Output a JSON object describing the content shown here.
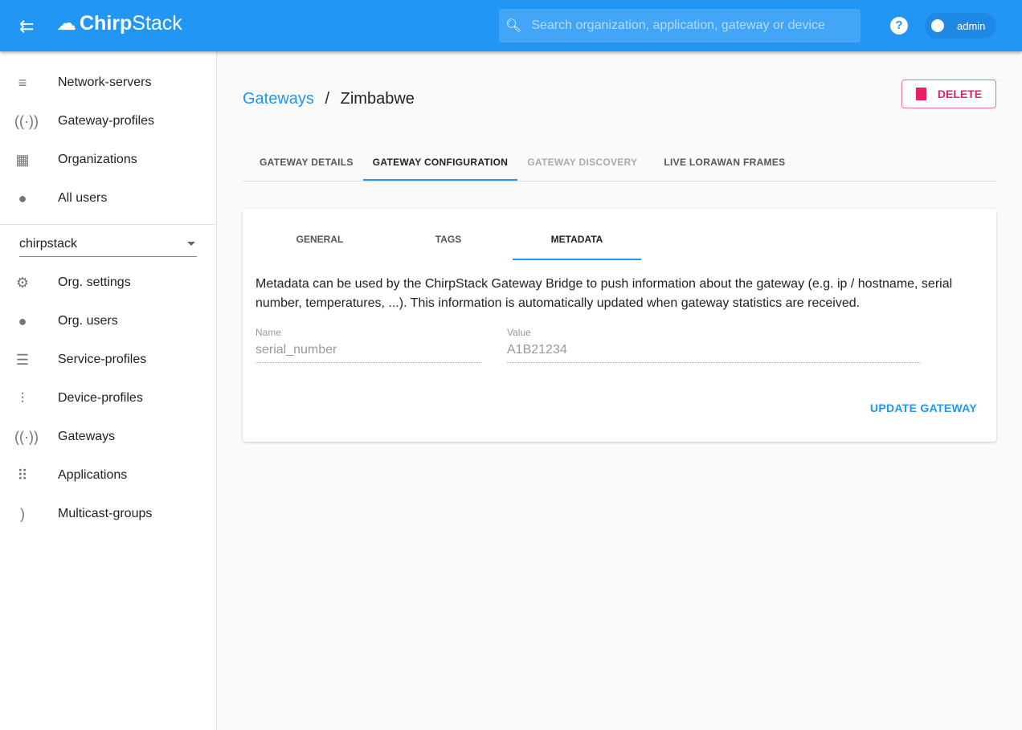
{
  "topbar": {
    "brand_a": "Chirp",
    "brand_b": "Stack",
    "search_placeholder": "Search organization, application, gateway or device",
    "user": "admin",
    "help": "?"
  },
  "sidebar": {
    "admin_items": [
      {
        "label": "Network-servers",
        "icon": "≡"
      },
      {
        "label": "Gateway-profiles",
        "icon": "((·))"
      },
      {
        "label": "Organizations",
        "icon": "▦"
      },
      {
        "label": "All users",
        "icon": "●"
      }
    ],
    "org": "chirpstack",
    "org_items": [
      {
        "label": "Org. settings",
        "icon": "⚙"
      },
      {
        "label": "Org. users",
        "icon": "●"
      },
      {
        "label": "Service-profiles",
        "icon": "☰"
      },
      {
        "label": "Device-profiles",
        "icon": "⫶"
      },
      {
        "label": "Gateways",
        "icon": "((·))"
      },
      {
        "label": "Applications",
        "icon": "⠿"
      },
      {
        "label": "Multicast-groups",
        "icon": ")"
      }
    ]
  },
  "breadcrumb": {
    "parent": "Gateways",
    "sep": "/",
    "current": "Zimbabwe"
  },
  "delete_label": "DELETE",
  "tabs": [
    "GATEWAY DETAILS",
    "GATEWAY CONFIGURATION",
    "GATEWAY DISCOVERY",
    "LIVE LORAWAN FRAMES"
  ],
  "card": {
    "tabs": [
      "GENERAL",
      "TAGS",
      "METADATA"
    ],
    "description": "Metadata can be used by the ChirpStack Gateway Bridge to push information about the gateway (e.g. ip / hostname, serial number, temperatures, ...). This information is automatically updated when gateway statistics are received.",
    "name_label": "Name",
    "name_value": "serial_number",
    "value_label": "Value",
    "value_value": "A1B21234",
    "update_label": "UPDATE GATEWAY"
  }
}
